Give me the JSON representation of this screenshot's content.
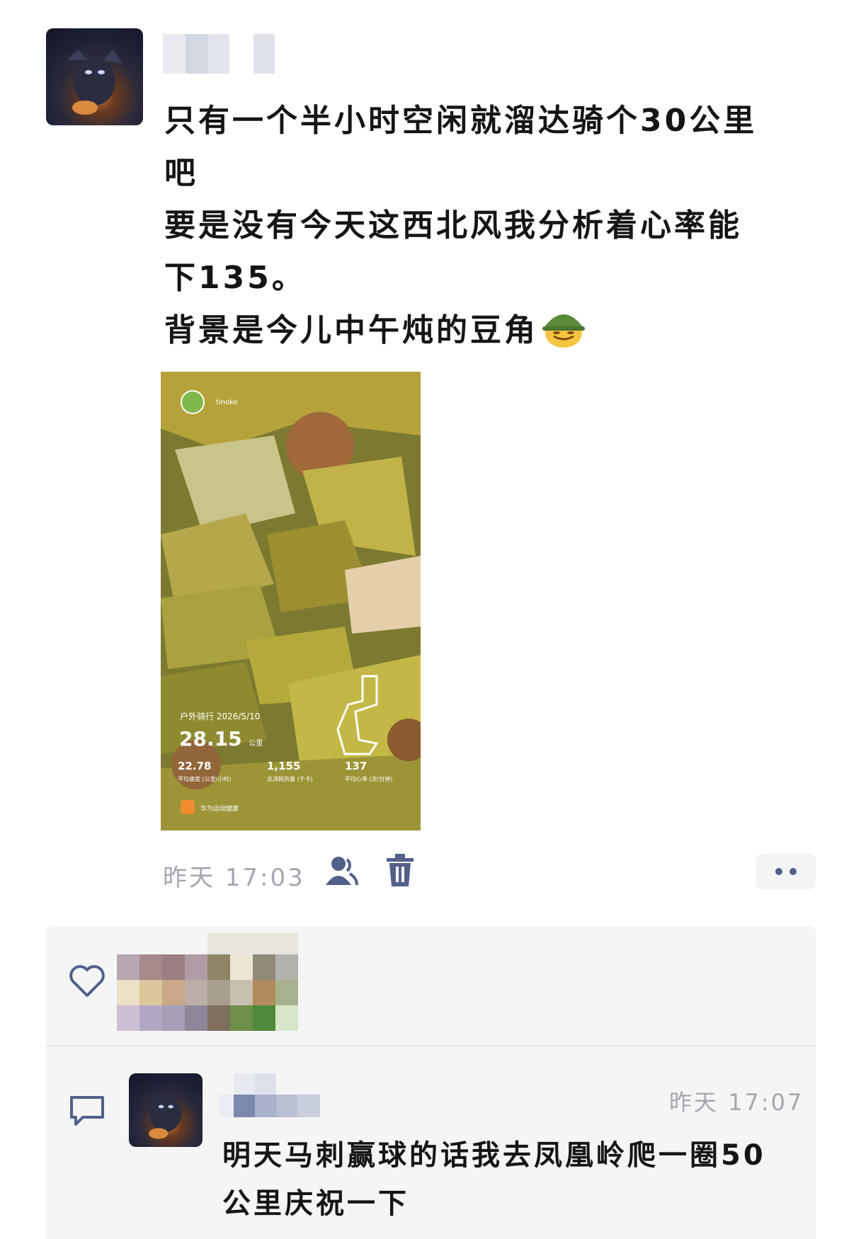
{
  "post": {
    "text_lines": [
      "只有一个半小时空闲就溜达骑个30公里",
      "吧",
      "要是没有今天这西北风我分析着心率能",
      "下135。",
      "背景是今儿中午炖的豆角"
    ],
    "emoji": "helmet-smile-emoji",
    "time": "昨天  17:03"
  },
  "photo": {
    "app_name": "tinoke",
    "ride_title": "户外骑行 2026/5/10",
    "distance_value": "28.15",
    "distance_unit": "公里",
    "stats": [
      {
        "value": "22.78",
        "label": "平均速度 (公里/小时)"
      },
      {
        "value": "1,155",
        "label": "总消耗热量 (千卡)"
      },
      {
        "value": "137",
        "label": "平均心率 (次/分钟)"
      }
    ],
    "brand": "华为运动健康"
  },
  "actions": {
    "visibility_icon": "contacts-icon",
    "delete_icon": "trash-icon",
    "more_icon": "more-dots-icon"
  },
  "likes": {
    "icon": "heart-icon"
  },
  "comment": {
    "icon": "comment-icon",
    "time": "昨天  17:07",
    "text_lines": [
      "明天马刺赢球的话我去凤凰岭爬一圈50",
      "公里庆祝一下"
    ]
  },
  "colors": {
    "link_blue": "#52608a",
    "meta_gray": "#a3a7b0",
    "comment_bg": "#f5f5f6"
  }
}
